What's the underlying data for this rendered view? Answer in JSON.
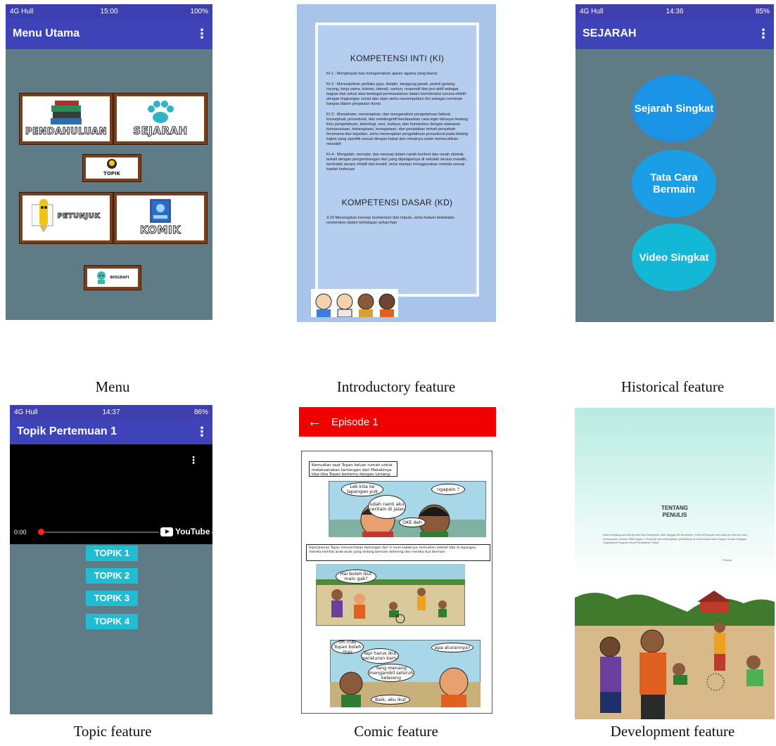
{
  "menu": {
    "status": {
      "left": "4G Hull",
      "time": "15:00",
      "right": "100%"
    },
    "title": "Menu Utama",
    "tiles": {
      "pendahuluan": "PENDAHULUAN",
      "sejarah": "SEJARAH",
      "topik": "TOPIK",
      "petunjuk": "PETUNJUK",
      "komik": "KOMIK",
      "biografi": "BIOGRAFI"
    }
  },
  "intro": {
    "ki_title": "KOMPETENSI INTI (KI)",
    "ki": [
      "KI-1 : Menghayati dan mengamalkan ajaran agama yang dianut",
      "KI-2 : Menunjukkan perilaku jujur, disiplin, tanggung jawab, peduli (gotong royong, kerja sama, toleran, damai), santun, responsif dan pro-aktif sebagai bagian dari solusi atas berbagai permasalahan dalam berinteraksi secara efektif dengan lingkungan sosial dan alam serta menempatkan diri sebagai cerminan bangsa dalam pergaulan dunia",
      "KI-3 : Memahami, menerapkan, dan menganalisis pengetahuan faktual, konseptual, prosedural, dan metakognitif berdasarkan rasa ingin tahunya tentang ilmu pengetahuan, teknologi, seni, budaya, dan humaniora dengan wawasan kemanusiaan, kebangsaan, kenegaraan, dan peradaban terkait penyebab fenomena dan kejadian, serta menerapkan pengetahuan prosedural pada bidang kajian yang spesifik sesuai dengan bakat dan minatnya untuk memecahkan masalah",
      "KI-4 : Mengolah, menalar, dan menyaji dalam ranah konkret dan ranah abstrak terkait dengan pengembangan dari yang dipelajarinya di sekolah secara mandiri, bertindak secara efektif dan kreatif, serta mampu menggunakan metoda sesuai kaidah keilmuan"
    ],
    "kd_title": "KOMPETENSI DASAR (KD)",
    "kd": "3.10 Menerapkan konsep momentum dan impuls, serta hukum kekekalan momentum dalam kehidupan sehari-hari"
  },
  "history": {
    "status": {
      "left": "4G Hull",
      "time": "14:36",
      "right": "85%"
    },
    "title": "SEJARAH",
    "buttons": [
      "Sejarah Singkat",
      "Tata Cara Bermain",
      "Video Singkat"
    ],
    "colors": [
      "#1a93e6",
      "#1a9ee6",
      "#12b8d6"
    ]
  },
  "topic": {
    "status": {
      "left": "4G Hull",
      "time": "14:37",
      "right": "86%"
    },
    "title": "Topik Pertemuan 1",
    "video_time": "0:00",
    "video_brand": "YouTube",
    "buttons": [
      "TOPIK 1",
      "TOPIK 2",
      "TOPIK 3",
      "TOPIK 4"
    ]
  },
  "comic": {
    "title": "Episode 1",
    "caption1": "Kemudian saat Topan keluar rumah untuk melaksanakan tantangan dari Makakinya tiba-tiba Topan bertemu dengan Lintang.",
    "b1": "Lek kita ke lapangan yuk",
    "b2": "ngapain ?",
    "b3": "udah nanti aku ceritain di jalan",
    "b4": "OKE deh",
    "caption2": "Diperjalanan Topan menceritakan tantangan dari si nuno kakeknya, kemudian setelah tiba di lapangan, mereka melihat anak-anak yang sedang bermain kelereng dan mereka ikut bermain",
    "b5": "Hai boleh ikut main gak?",
    "b6": "Oh mas Topan boleh mas",
    "b7": "Tapi harus ikut peraturan kami",
    "b8": "apa aturannya?",
    "b9": "Yang menang mengambil seluruh kelereng",
    "b10": "Baik, aku ikut"
  },
  "development": {
    "heading_line1": "TENTANG",
    "heading_line2": "PENULIS",
    "para": "Nama lengkap penulis Annisa Eka Dahniyarti, lahir tanggal 06 November 1996 di Boyolali dan anak ke dua dari dua bersaudara, lulusan SMA Negeri 1 Boyolali dan melanjutkan pendidikan di Universitas Islam Negeri Sunan Kalijaga Yogyakarta Program Studi Pendidikan Fisika.",
    "sig": "Penulis"
  },
  "captions": [
    "Menu",
    "Introductory feature",
    "Historical feature",
    "Topic feature",
    "Comic feature",
    "Development feature"
  ]
}
